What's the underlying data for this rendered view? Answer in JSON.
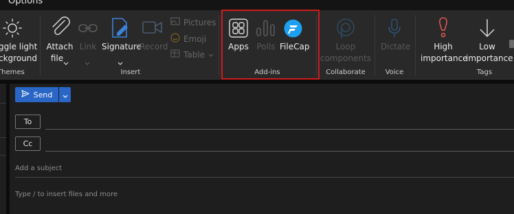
{
  "window": {
    "title": "Options"
  },
  "ribbon": {
    "themes": {
      "toggle_line1": "ggle light",
      "toggle_line2": "ckground",
      "group": "Themes"
    },
    "insert": {
      "attach_line1": "Attach",
      "attach_line2": "file",
      "link": "Link",
      "signature": "Signature",
      "record": "Record",
      "pictures": "Pictures",
      "emoji": "Emoji",
      "table": "Table",
      "group": "Insert"
    },
    "addins": {
      "apps": "Apps",
      "polls": "Polls",
      "filecap": "FileCap",
      "group": "Add-ins"
    },
    "collaborate": {
      "loop_line1": "Loop",
      "loop_line2": "components",
      "group": "Collaborate"
    },
    "voice": {
      "dictate": "Dictate",
      "group": "Voice"
    },
    "tags": {
      "high_line1": "High",
      "high_line2": "importance",
      "low_line1": "Low",
      "low_line2": "importance",
      "group": "Tags"
    },
    "colors": {
      "accent": "#2a66c6",
      "highlight": "#d11b1b",
      "importance_high": "#e05555",
      "filecap": "#1ea0f0"
    }
  },
  "compose": {
    "send": "Send",
    "to": "To",
    "cc": "Cc",
    "subject_placeholder": "Add a subject",
    "body_placeholder": "Type / to insert files and more"
  }
}
